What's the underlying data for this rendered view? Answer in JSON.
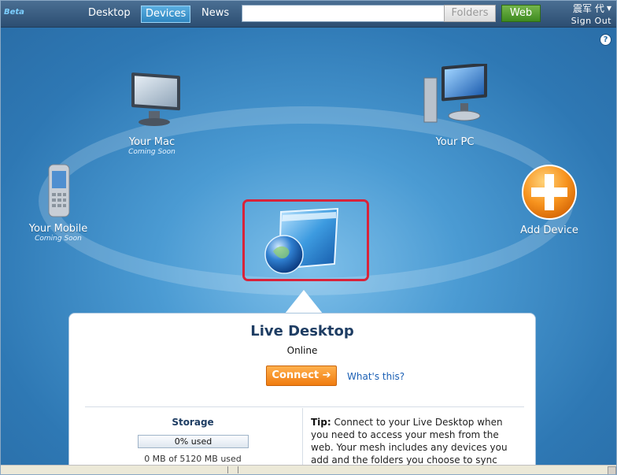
{
  "topbar": {
    "beta": "Beta",
    "tabs": [
      {
        "label": "Desktop",
        "active": false
      },
      {
        "label": "Devices",
        "active": true
      },
      {
        "label": "News",
        "active": false
      }
    ],
    "search_value": "",
    "folders_label": "Folders",
    "web_label": "Web",
    "user_name": "震军 代",
    "sign_out": "Sign Out"
  },
  "help_label": "?",
  "devices": {
    "mac": {
      "label": "Your Mac",
      "status": "Coming Soon"
    },
    "pc": {
      "label": "Your PC"
    },
    "mobile": {
      "label": "Your Mobile",
      "status": "Coming Soon"
    },
    "add": {
      "label": "Add Device"
    }
  },
  "card": {
    "title": "Live Desktop",
    "status": "Online",
    "connect_label": "Connect",
    "whats_this": "What's this?",
    "storage_title": "Storage",
    "progress_label": "0% used",
    "progress_value": 0,
    "storage_used": "0 MB of 5120 MB used",
    "tip_label": "Tip:",
    "tip_text": "Connect to your Live Desktop when you need to access your mesh from the web. Your mesh includes any devices you add and the folders you choose to sync and share."
  },
  "colors": {
    "accent_orange": "#f07c10",
    "selection_red": "#d8233a",
    "link_blue": "#1a5fb4",
    "background_blue": "#2e78b4"
  }
}
